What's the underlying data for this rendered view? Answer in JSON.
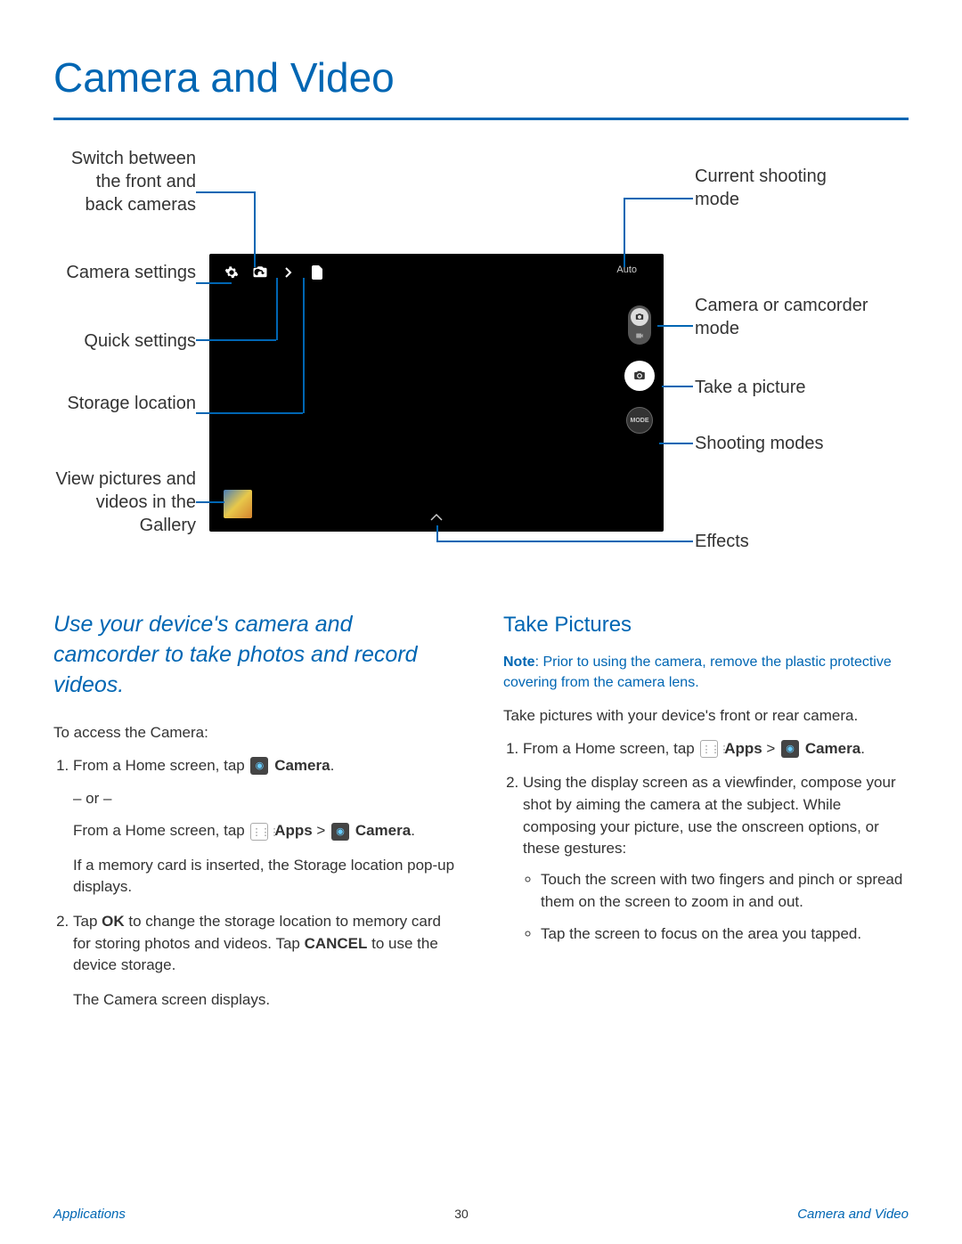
{
  "title": "Camera and Video",
  "diagram": {
    "auto_label": "Auto",
    "mode_btn_text": "MODE",
    "callouts_left": {
      "switch_cameras": "Switch between the front and back cameras",
      "camera_settings": "Camera settings",
      "quick_settings": "Quick settings",
      "storage_location": "Storage location",
      "gallery": "View pictures and videos in the Gallery"
    },
    "callouts_right": {
      "current_mode": "Current shooting mode",
      "cam_or_camcorder": "Camera or camcorder mode",
      "take_picture": "Take a picture",
      "shooting_modes": "Shooting modes",
      "effects": "Effects"
    }
  },
  "intro": "Use your device's camera and camcorder to take photos and record videos.",
  "left_col": {
    "access_label": "To access the Camera:",
    "step1_a": "From a Home screen, tap ",
    "step1_a_bold": "Camera",
    "or": "– or –",
    "step1_b": "From a Home screen, tap ",
    "step1_b_apps": "Apps",
    "gt": " > ",
    "step1_b_camera": "Camera",
    "step1_c": "If a memory card is inserted, the Storage location pop-up displays.",
    "step2_a": "Tap ",
    "step2_ok": "OK",
    "step2_b": " to change the storage location to memory card for storing photos and videos. Tap ",
    "step2_cancel": "CANCEL",
    "step2_c": " to use the device storage.",
    "step2_d": "The Camera screen displays."
  },
  "right_col": {
    "heading": "Take Pictures",
    "note_label": "Note",
    "note_text": ": Prior to using the camera, remove the plastic protective covering from the camera lens.",
    "body": "Take pictures with your device's front or rear camera.",
    "step1": "From a Home screen, tap ",
    "step1_apps": "Apps",
    "gt": " > ",
    "step1_camera": "Camera",
    "step2": "Using the display screen as a viewfinder, compose your shot by aiming the camera at the subject. While composing your picture, use the onscreen options, or these gestures:",
    "bullet1": "Touch the screen with two fingers and pinch or spread them on the screen to zoom in and out.",
    "bullet2": "Tap the screen to focus on the area you tapped."
  },
  "footer": {
    "left": "Applications",
    "page": "30",
    "right": "Camera and Video"
  }
}
